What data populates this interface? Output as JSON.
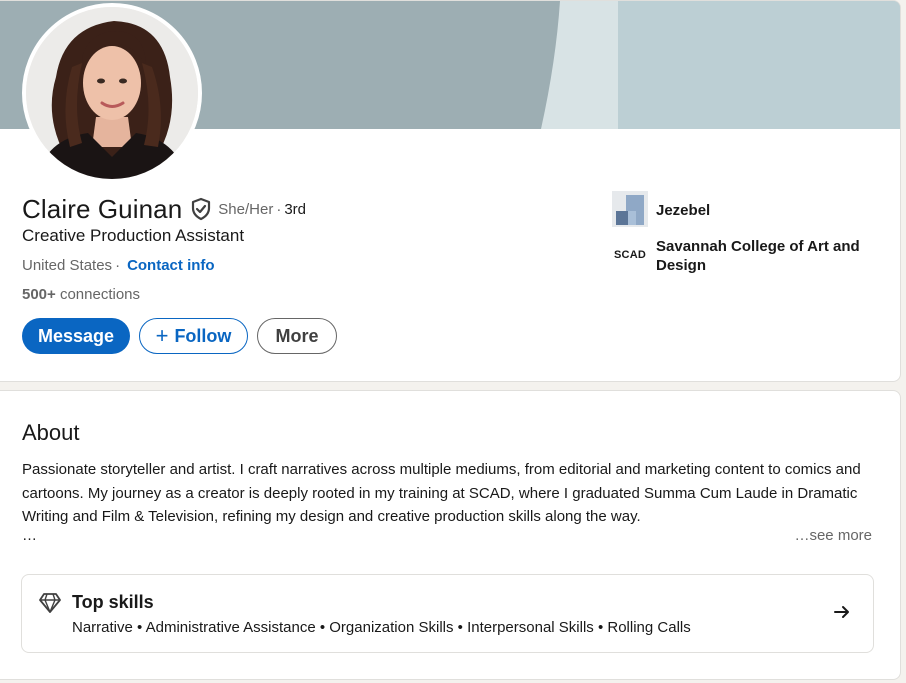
{
  "profile": {
    "name": "Claire Guinan",
    "pronouns": "She/Her",
    "degree": "3rd",
    "headline": "Creative Production Assistant",
    "location": "United States",
    "contact_info": "Contact info",
    "connections_count": "500+",
    "connections_label": "connections",
    "verified_icon": "shield-check-icon"
  },
  "actions": {
    "message": "Message",
    "follow": "Follow",
    "more": "More"
  },
  "experience": {
    "company": "Jezebel",
    "school": "Savannah College of Art and Design",
    "school_logo_text": "SCAD"
  },
  "about": {
    "title": "About",
    "text": "Passionate storyteller and artist. I craft narratives across multiple mediums, from editorial and marketing content to comics and cartoons. My journey as a creator is deeply rooted in my training at SCAD, where I graduated Summa Cum Laude in Dramatic Writing and Film & Television, refining my design and creative production skills along the way.",
    "ellipsis": "…",
    "see_more": "…see more"
  },
  "top_skills": {
    "title": "Top skills",
    "list": "Narrative • Administrative Assistance • Organization Skills • Interpersonal Skills • Rolling Calls",
    "icon": "diamond-icon",
    "arrow_icon": "arrow-right-icon"
  },
  "colors": {
    "brand_blue": "#0a66c2",
    "banner_dark": "#9daeb3",
    "banner_light": "#bccfd4",
    "banner_stripe": "#d8e3e5"
  }
}
